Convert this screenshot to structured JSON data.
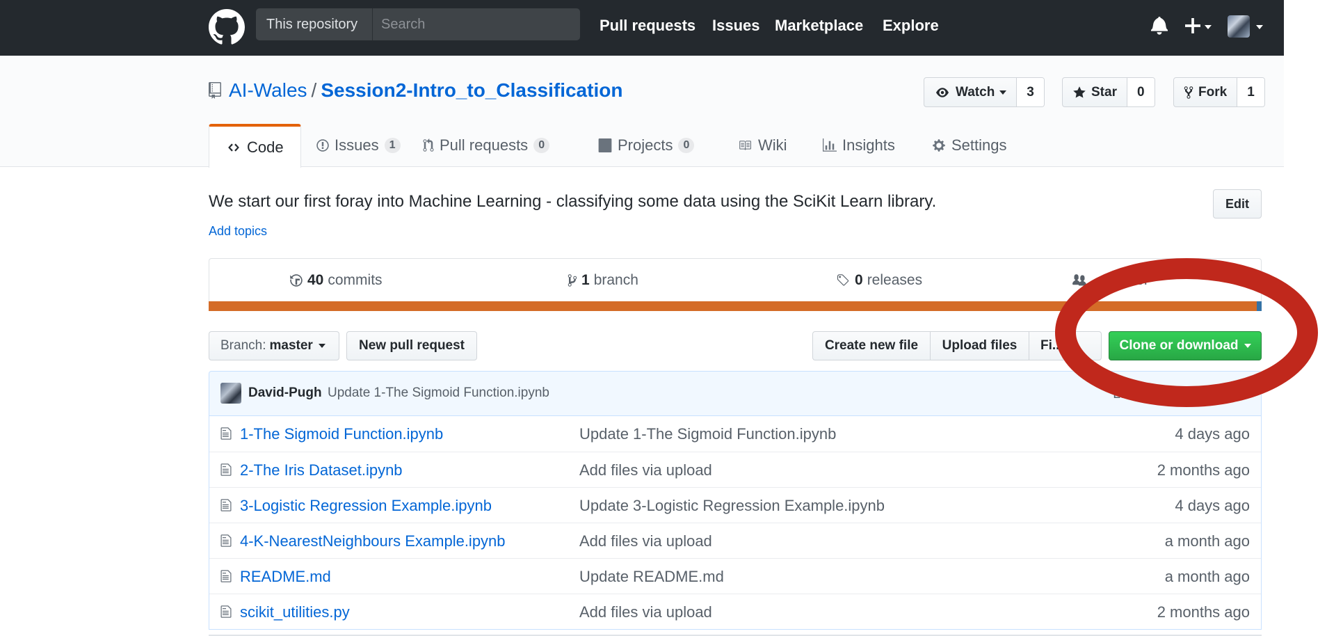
{
  "header": {
    "scope_label": "This repository",
    "search_placeholder": "Search",
    "nav": [
      "Pull requests",
      "Issues",
      "Marketplace",
      "Explore"
    ],
    "icons": [
      "github-logo",
      "bell-icon",
      "plus-icon",
      "avatar"
    ]
  },
  "repo": {
    "owner": "AI-Wales",
    "separator": "/",
    "name": "Session2-Intro_to_Classification",
    "watch": {
      "label": "Watch",
      "count": "3"
    },
    "star": {
      "label": "Star",
      "count": "0"
    },
    "fork": {
      "label": "Fork",
      "count": "1"
    }
  },
  "tabs": [
    {
      "label": "Code",
      "selected": true
    },
    {
      "label": "Issues",
      "count": "1"
    },
    {
      "label": "Pull requests",
      "count": "0"
    },
    {
      "label": "Projects",
      "count": "0"
    },
    {
      "label": "Wiki"
    },
    {
      "label": "Insights"
    },
    {
      "label": "Settings"
    }
  ],
  "description": "We start our first foray into Machine Learning - classifying some data using the SciKit Learn library.",
  "add_topics": "Add topics",
  "edit_label": "Edit",
  "summary": {
    "commits": {
      "count": "40",
      "label": "commits"
    },
    "branches": {
      "count": "1",
      "label": "branch"
    },
    "releases": {
      "count": "0",
      "label": "releases"
    },
    "contributors_label": "...tributor"
  },
  "file_nav": {
    "branch_prefix": "Branch:",
    "branch_name": "master",
    "new_pr": "New pull request",
    "create_file": "Create new file",
    "upload_files": "Upload files",
    "find_file": "Fi...ile",
    "clone": "Clone or download"
  },
  "latest_commit": {
    "author": "David-Pugh",
    "message": "Update 1-The Sigmoid Function.ipynb",
    "latest_label": "Latest comm"
  },
  "files": [
    {
      "name": "1-The Sigmoid Function.ipynb",
      "message": "Update 1-The Sigmoid Function.ipynb",
      "age": "4 days ago"
    },
    {
      "name": "2-The Iris Dataset.ipynb",
      "message": "Add files via upload",
      "age": "2 months ago"
    },
    {
      "name": "3-Logistic Regression Example.ipynb",
      "message": "Update 3-Logistic Regression Example.ipynb",
      "age": "4 days ago"
    },
    {
      "name": "4-K-NearestNeighbours Example.ipynb",
      "message": "Add files via upload",
      "age": "a month ago"
    },
    {
      "name": "README.md",
      "message": "Update README.md",
      "age": "a month ago"
    },
    {
      "name": "scikit_utilities.py",
      "message": "Add files via upload",
      "age": "2 months ago"
    }
  ],
  "colors": {
    "header_bg": "#24292e",
    "link": "#0366d6",
    "tab_accent": "#e36209",
    "clone_green": "#28a745",
    "annotation_red": "#c0281c"
  }
}
